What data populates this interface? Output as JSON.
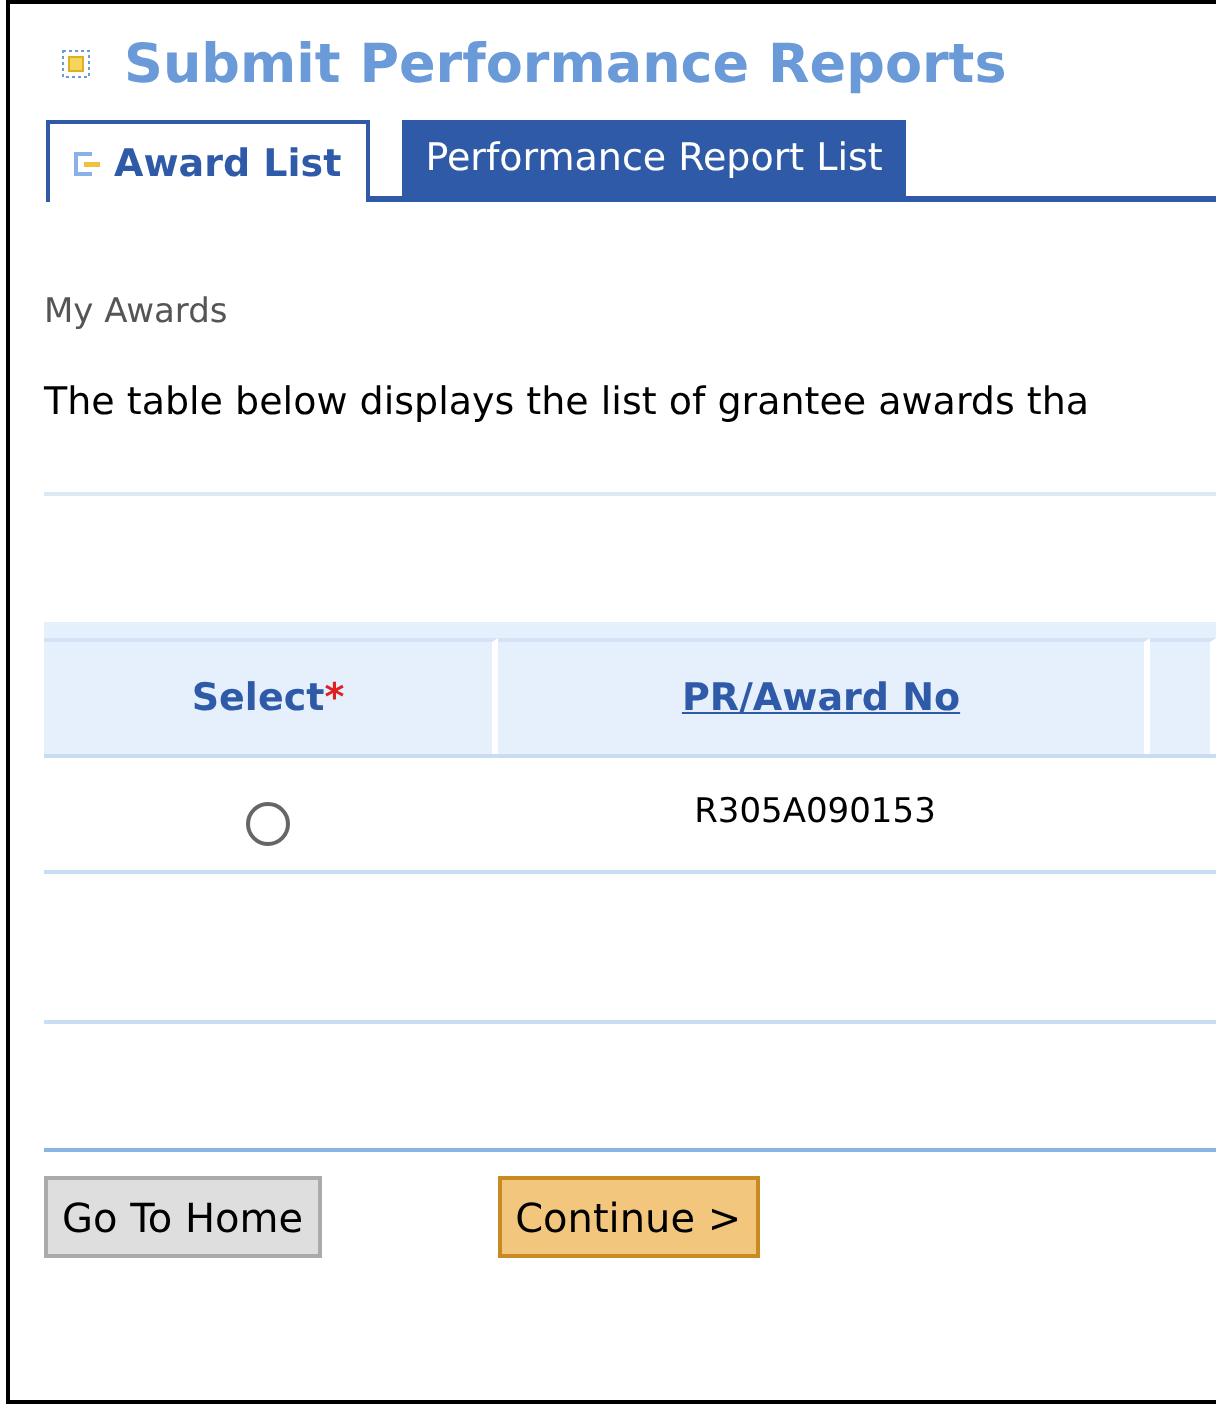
{
  "page_title": "Submit Performance Reports",
  "tabs": [
    {
      "label": "Award List",
      "selected": true
    },
    {
      "label": "Performance Report List",
      "selected": false
    }
  ],
  "section_title": "My Awards",
  "description": "The table below displays the list of grantee awards tha",
  "table": {
    "columns": [
      {
        "kind": "text",
        "label": "Select",
        "mark": "*"
      },
      {
        "kind": "link",
        "label": "PR/Award No"
      },
      {
        "kind": "blank"
      }
    ],
    "rows": [
      {
        "selected": false,
        "award_no": "R305A090153"
      }
    ]
  },
  "buttons": [
    {
      "label": "Go To Home",
      "kind": "secondary"
    },
    {
      "label": "Continue >",
      "kind": "primary"
    }
  ]
}
